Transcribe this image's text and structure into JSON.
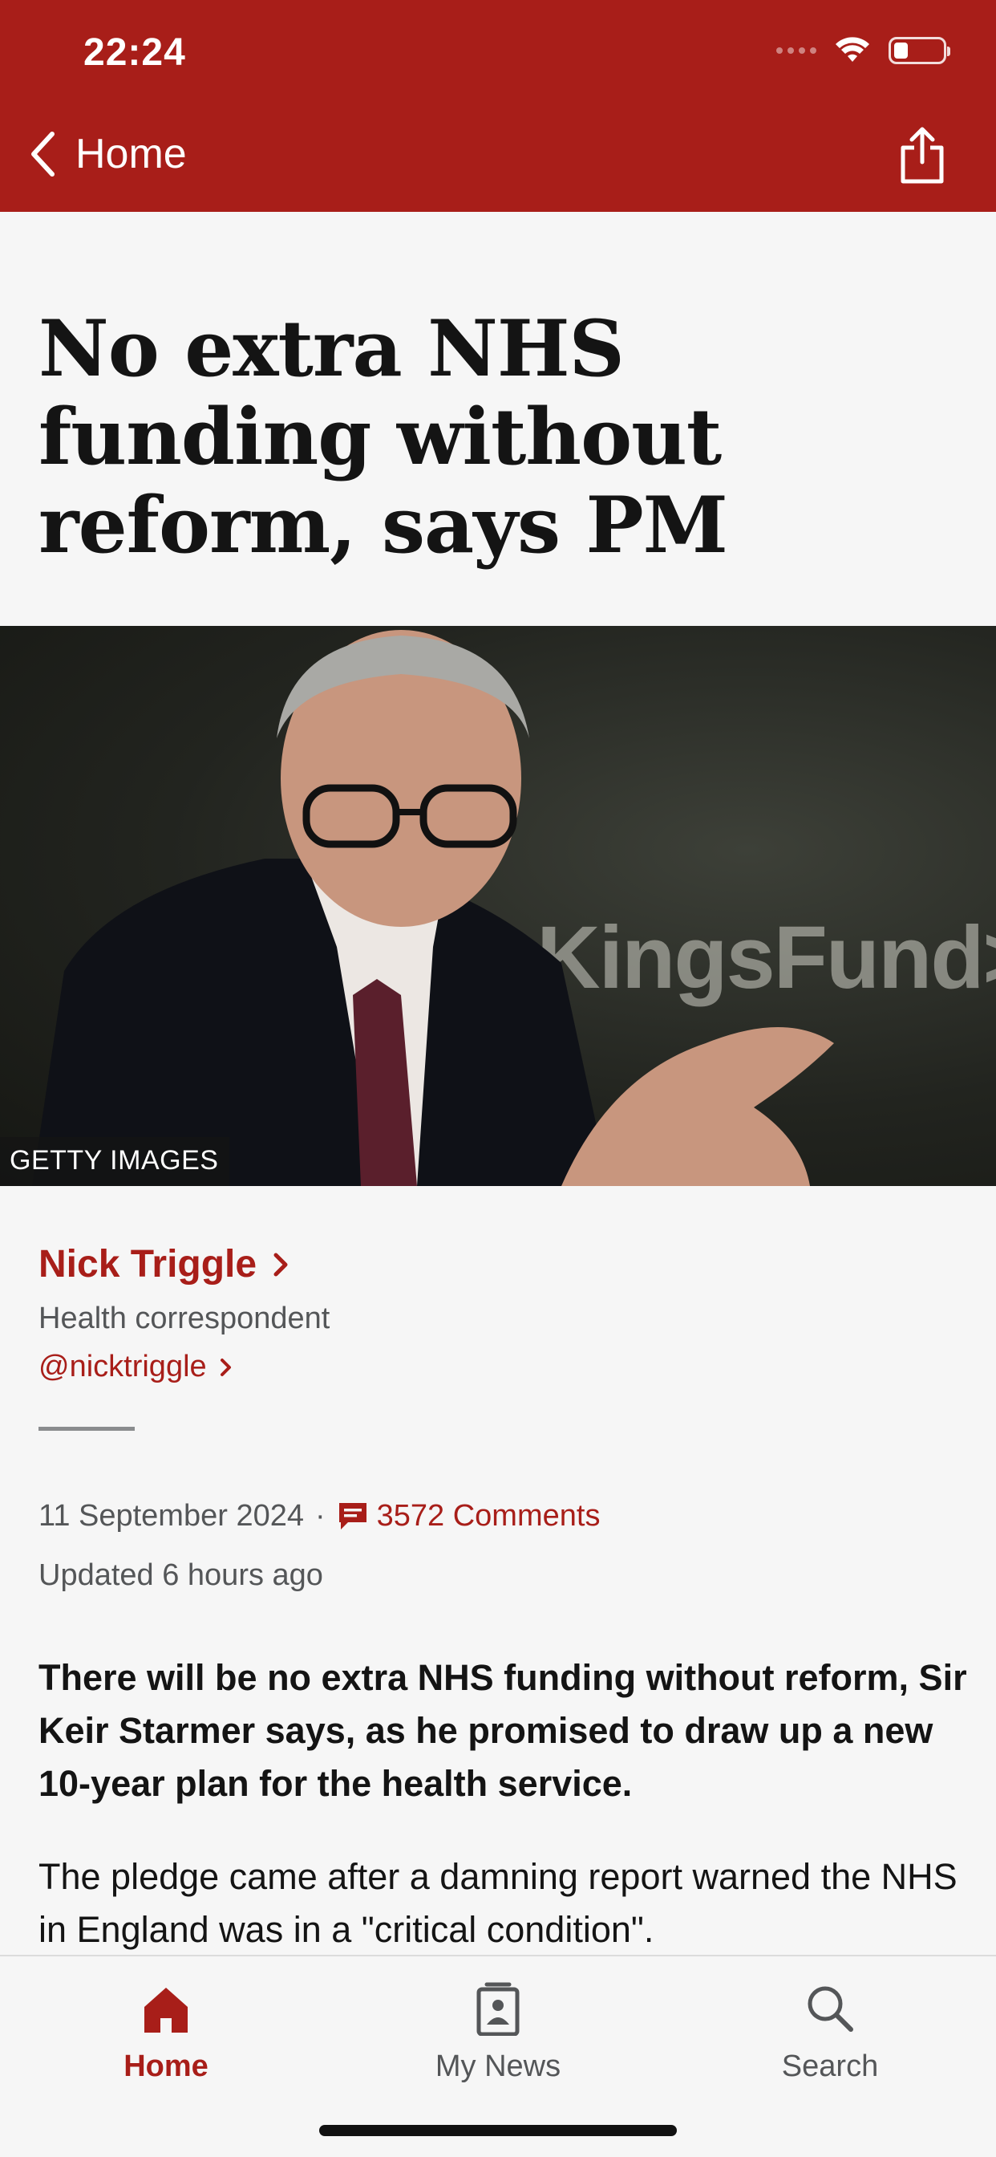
{
  "status_bar": {
    "time": "22:24",
    "battery_level": 0.3
  },
  "nav": {
    "back_label": "Home",
    "share_icon": "share-icon"
  },
  "article": {
    "headline": "No extra NHS funding without reform, says PM",
    "image": {
      "credit": "GETTY IMAGES",
      "watermark_text": "eKingsFund>"
    },
    "author": {
      "name": "Nick Triggle",
      "role": "Health correspondent",
      "handle": "@nicktriggle"
    },
    "date": "11 September 2024",
    "separator": "·",
    "comments": "3572 Comments",
    "updated": "Updated 6 hours ago",
    "intro": "There will be no extra NHS funding without reform, Sir Keir Starmer says, as he promised to draw up a new 10-year plan for the health service.",
    "paragraph": "The pledge came after a damning report warned the NHS in England was in a \"critical condition\"."
  },
  "tabs": [
    {
      "label": "Home",
      "icon": "home-icon",
      "active": true
    },
    {
      "label": "My News",
      "icon": "my-news-icon",
      "active": false
    },
    {
      "label": "Search",
      "icon": "search-icon",
      "active": false
    }
  ],
  "colors": {
    "brand": "#a81e19",
    "background": "#f6f6f6",
    "text": "#141414",
    "muted": "#545658"
  }
}
